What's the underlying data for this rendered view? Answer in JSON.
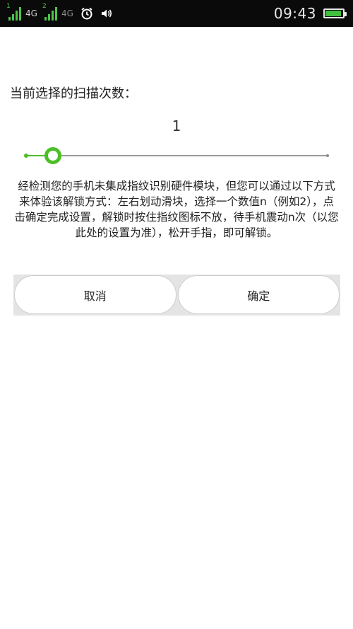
{
  "status_bar": {
    "sim1_index": "1",
    "sim1_network": "4G",
    "sim2_index": "2",
    "sim2_network": "4G",
    "time": "09:43",
    "battery_level": 0.92,
    "icons": [
      "signal-icon",
      "alarm-icon",
      "volume-icon",
      "battery-icon"
    ],
    "colors": {
      "signal_active": "#4cc44a",
      "signal_inactive": "#8a8a8a",
      "battery": "#3fc13d"
    }
  },
  "scan": {
    "label": "当前选择的扫描次数：",
    "value": "1",
    "slider_fraction": 0.09,
    "accent_color": "#4cbf26"
  },
  "description": "经检测您的手机未集成指纹识别硬件模块，但您可以通过以下方式来体验该解锁方式：左右划动滑块，选择一个数值n（例如2），点击确定完成设置，解锁时按住指纹图标不放，待手机震动n次（以您此处的设置为准），松开手指，即可解锁。",
  "buttons": {
    "cancel_label": "取消",
    "confirm_label": "确定"
  }
}
